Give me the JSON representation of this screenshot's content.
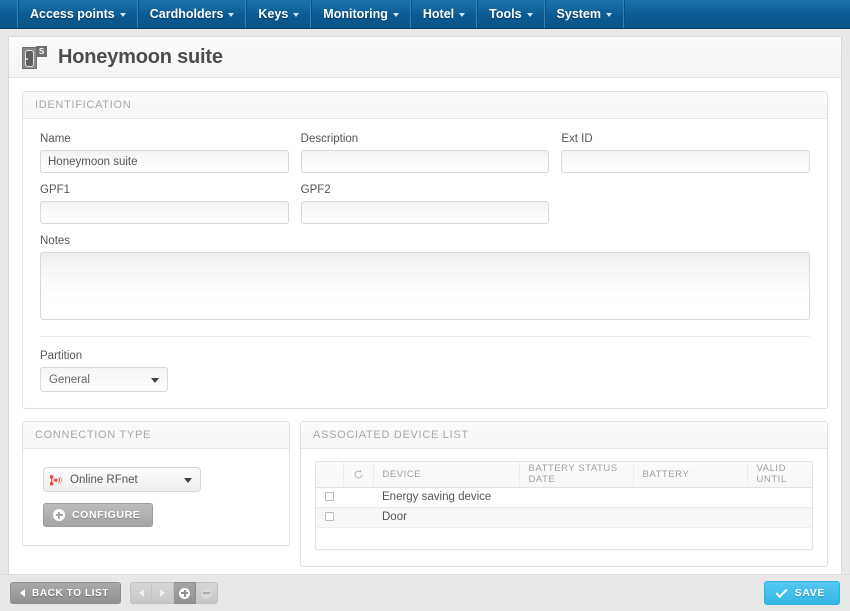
{
  "nav": {
    "items": [
      {
        "label": "Access points",
        "icon": "chevron-down-icon"
      },
      {
        "label": "Cardholders",
        "icon": "chevron-down-icon"
      },
      {
        "label": "Keys",
        "icon": "chevron-down-icon"
      },
      {
        "label": "Monitoring",
        "icon": "chevron-down-icon"
      },
      {
        "label": "Hotel",
        "icon": "chevron-down-icon"
      },
      {
        "label": "Tools",
        "icon": "chevron-down-icon"
      },
      {
        "label": "System",
        "icon": "chevron-down-icon"
      }
    ],
    "background_color": "#0c5a92"
  },
  "header": {
    "title": "Honeymoon suite",
    "icon": "door-icon",
    "icon_badge": "S"
  },
  "identification": {
    "panel_title": "IDENTIFICATION",
    "name": {
      "label": "Name",
      "value": "Honeymoon suite",
      "placeholder": ""
    },
    "description": {
      "label": "Description",
      "value": "",
      "placeholder": ""
    },
    "ext_id": {
      "label": "Ext ID",
      "value": "",
      "placeholder": ""
    },
    "gpf1": {
      "label": "GPF1",
      "value": "",
      "placeholder": ""
    },
    "gpf2": {
      "label": "GPF2",
      "value": "",
      "placeholder": ""
    },
    "notes": {
      "label": "Notes",
      "value": "",
      "placeholder": ""
    },
    "partition": {
      "label": "Partition",
      "value": "General",
      "options": [
        "General"
      ]
    }
  },
  "connection_type": {
    "panel_title": "CONNECTION TYPE",
    "select": {
      "value": "Online RFnet",
      "options": [
        "Online RFnet"
      ],
      "icon": "rfnet-icon",
      "icon_color": "#e8433f"
    },
    "configure_button": {
      "label": "CONFIGURE",
      "icon": "plus-circle-icon"
    }
  },
  "associated_device_list": {
    "panel_title": "ASSOCIATED DEVICE LIST",
    "columns": [
      "",
      "refresh-icon",
      "DEVICE",
      "BATTERY STATUS DATE",
      "BATTERY",
      "VALID UNTIL"
    ],
    "rows": [
      {
        "selected": false,
        "device": "Energy saving device",
        "battery_status_date": "",
        "battery": "",
        "valid_until": ""
      },
      {
        "selected": false,
        "device": "Door",
        "battery_status_date": "",
        "battery": "",
        "valid_until": ""
      }
    ]
  },
  "footer": {
    "back_button": {
      "label": "BACK TO LIST",
      "icon": "chevron-left-icon"
    },
    "nav_buttons": [
      {
        "name": "previous",
        "icon": "chevron-left-icon"
      },
      {
        "name": "next",
        "icon": "chevron-right-icon"
      },
      {
        "name": "add",
        "icon": "plus-circle-icon"
      },
      {
        "name": "remove",
        "icon": "minus-circle-icon"
      }
    ],
    "save_button": {
      "label": "SAVE",
      "icon": "check-icon",
      "color": "#3bb9e8"
    }
  }
}
